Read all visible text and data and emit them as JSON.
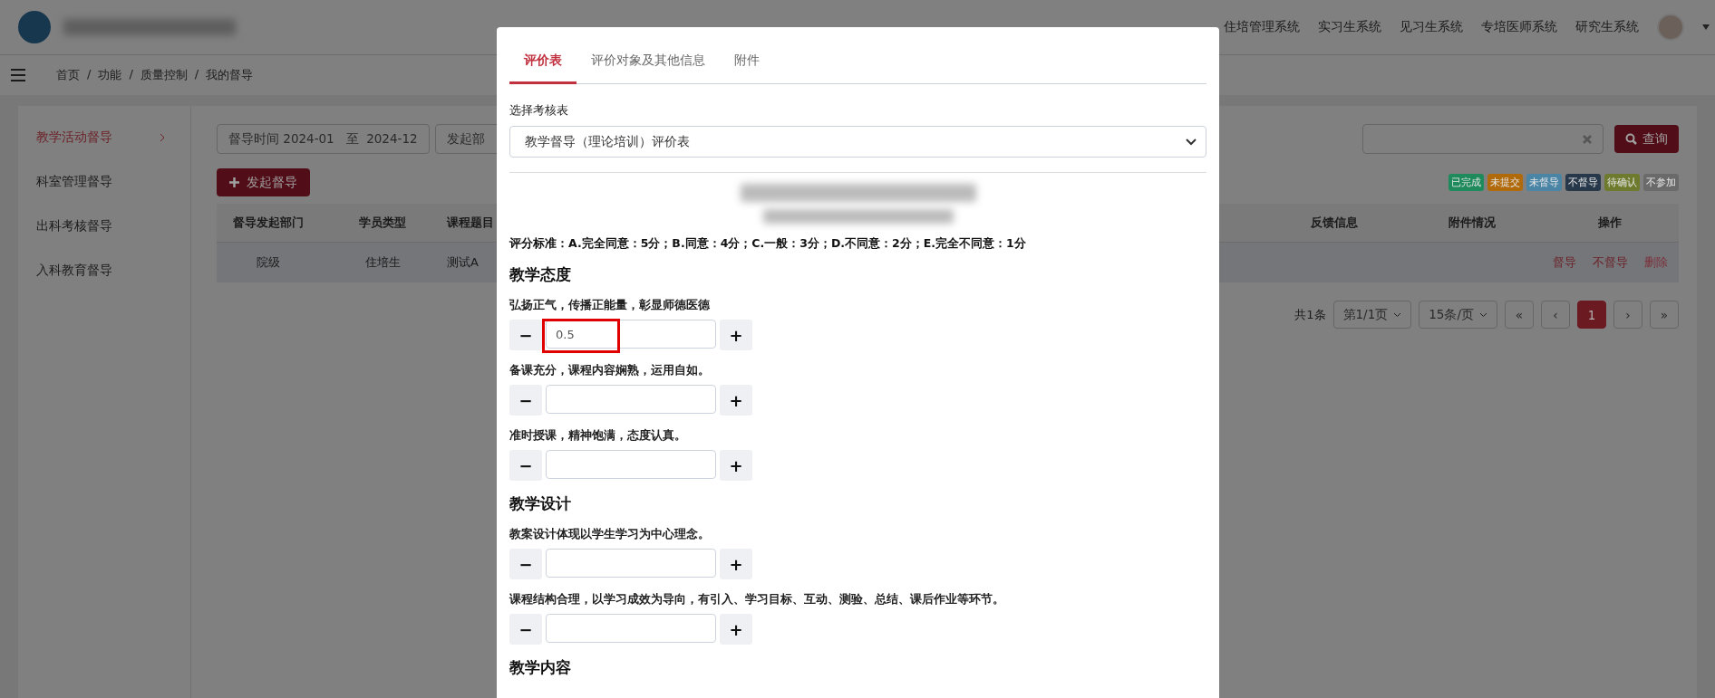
{
  "header": {
    "nav": [
      "住培管理系统",
      "实习生系统",
      "见习生系统",
      "专培医师系统",
      "研究生系统"
    ]
  },
  "breadcrumb": {
    "items": [
      "首页",
      "功能",
      "质量控制",
      "我的督导"
    ],
    "separator": "/"
  },
  "sidebar": {
    "items": [
      {
        "label": "教学活动督导",
        "selected": true
      },
      {
        "label": "科室管理督导",
        "selected": false
      },
      {
        "label": "出科考核督导",
        "selected": false
      },
      {
        "label": "入科教育督导",
        "selected": false
      }
    ]
  },
  "filters": {
    "date_label": "督导时间",
    "date_from": "2024-01",
    "date_sep": "至",
    "date_to": "2024-12",
    "department_label": "发起部",
    "search_button": "查询"
  },
  "legend": [
    {
      "label": "已完成",
      "color": "#1f8a5c"
    },
    {
      "label": "未提交",
      "color": "#b06a0a"
    },
    {
      "label": "未督导",
      "color": "#4a85a6"
    },
    {
      "label": "不督导",
      "color": "#27384a"
    },
    {
      "label": "待确认",
      "color": "#6e7a2d"
    },
    {
      "label": "不参加",
      "color": "#6a6a6a"
    }
  ],
  "start_button": "发起督导",
  "table": {
    "columns_left": [
      "督导发起部门",
      "学员类型",
      "课程题目"
    ],
    "columns_right": [
      "反馈信息",
      "附件情况",
      "操作"
    ],
    "rows": [
      {
        "cells_left": [
          "院级",
          "住培生",
          "测试A"
        ],
        "actions": [
          "督导",
          "不督导",
          "删除"
        ]
      }
    ]
  },
  "pagination": {
    "total": "共1条",
    "page_select": "第1/1页",
    "size_select": "15条/页",
    "buttons": [
      {
        "label": "«",
        "selected": false
      },
      {
        "label": "‹",
        "selected": false
      },
      {
        "label": "1",
        "selected": true
      },
      {
        "label": "›",
        "selected": false
      },
      {
        "label": "»",
        "selected": false
      }
    ]
  },
  "modal": {
    "tabs": [
      {
        "label": "评价表",
        "selected": true
      },
      {
        "label": "评价对象及其他信息",
        "selected": false
      },
      {
        "label": "附件",
        "selected": false
      }
    ],
    "select_label": "选择考核表",
    "select_value": "教学督导（理论培训）评价表",
    "criteria": "评分标准：A.完全同意：5分；B.同意：4分；C.一般：3分；D.不同意：2分；E.完全不同意：1分",
    "stepper_minus": "−",
    "stepper_plus": "+",
    "sections": [
      {
        "title": "教学态度",
        "items": [
          {
            "label": "弘扬正气，传播正能量，彰显师德医德",
            "value": "0.5",
            "highlighted": true
          },
          {
            "label": "备课充分，课程内容娴熟，运用自如。",
            "value": "",
            "highlighted": false
          },
          {
            "label": "准时授课，精神饱满，态度认真。",
            "value": "",
            "highlighted": false
          }
        ]
      },
      {
        "title": "教学设计",
        "items": [
          {
            "label": "教案设计体现以学生学习为中心理念。",
            "value": "",
            "highlighted": false
          },
          {
            "label": "课程结构合理，以学习成效为导向，有引入、学习目标、互动、测验、总结、课后作业等环节。",
            "value": "",
            "highlighted": false
          }
        ]
      },
      {
        "title": "教学内容"
      }
    ]
  }
}
